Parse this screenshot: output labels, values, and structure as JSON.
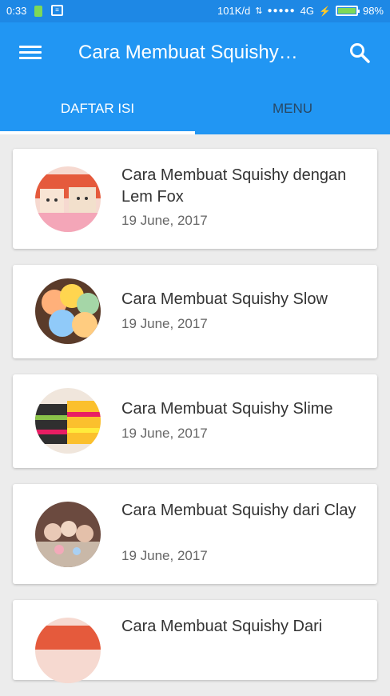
{
  "status": {
    "time": "0:33",
    "net_speed": "101K/d",
    "signal_type": "4G",
    "battery": "98%"
  },
  "appbar": {
    "title": "Cara Membuat Squishy…",
    "menu_icon": "hamburger-menu-icon",
    "search_icon": "search-icon"
  },
  "tabs": [
    {
      "label": "DAFTAR ISI",
      "active": true
    },
    {
      "label": "MENU",
      "active": false
    }
  ],
  "articles": [
    {
      "title": "Cara Membuat Squishy dengan Lem Fox",
      "date": "19 June, 2017"
    },
    {
      "title": "Cara Membuat Squishy Slow",
      "date": "19 June, 2017"
    },
    {
      "title": "Cara Membuat Squishy Slime",
      "date": "19 June, 2017"
    },
    {
      "title": "Cara Membuat Squishy dari Clay",
      "date": "19 June, 2017"
    },
    {
      "title": "Cara Membuat Squishy Dari",
      "date": ""
    }
  ],
  "colors": {
    "primary": "#2196f3",
    "status_bar": "#1e88e5",
    "background": "#ececec"
  }
}
